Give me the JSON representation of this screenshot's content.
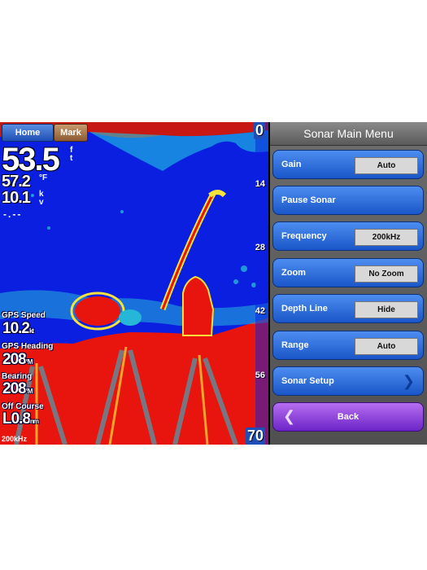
{
  "top_buttons": {
    "home": "Home",
    "mark": "Mark"
  },
  "readouts": {
    "depth": "53.5",
    "depth_unit_1": "f",
    "depth_unit_2": "t",
    "temp": "57.2",
    "temp_unit": "°F",
    "speed": "10.1",
    "speed_unit": "k",
    "speed_unit_2": "v",
    "extra": "-.--"
  },
  "data_fields": [
    {
      "label": "GPS Speed",
      "value": "10.2",
      "unit": "kt"
    },
    {
      "label": "GPS Heading",
      "value": "208",
      "unit": "°M"
    },
    {
      "label": "Bearing",
      "value": "208",
      "unit": "°M"
    },
    {
      "label": "Off Course",
      "value": "L0.8",
      "unit": "nm"
    }
  ],
  "frequency_tag": "200kHz",
  "depth_scale": [
    "0",
    "14",
    "28",
    "42",
    "56",
    "70"
  ],
  "menu": {
    "title": "Sonar Main Menu",
    "items": [
      {
        "label": "Gain",
        "value": "Auto"
      },
      {
        "label": "Pause Sonar",
        "value": ""
      },
      {
        "label": "Frequency",
        "value": "200kHz"
      },
      {
        "label": "Zoom",
        "value": "No Zoom"
      },
      {
        "label": "Depth Line",
        "value": "Hide"
      },
      {
        "label": "Range",
        "value": "Auto"
      },
      {
        "label": "Sonar Setup",
        "value": ""
      }
    ],
    "back": "Back"
  },
  "colors": {
    "water": "#0a1fe0",
    "bottom": "#e8140e",
    "menu_button": "#2a6ee0",
    "back_button": "#8a3ee0"
  }
}
